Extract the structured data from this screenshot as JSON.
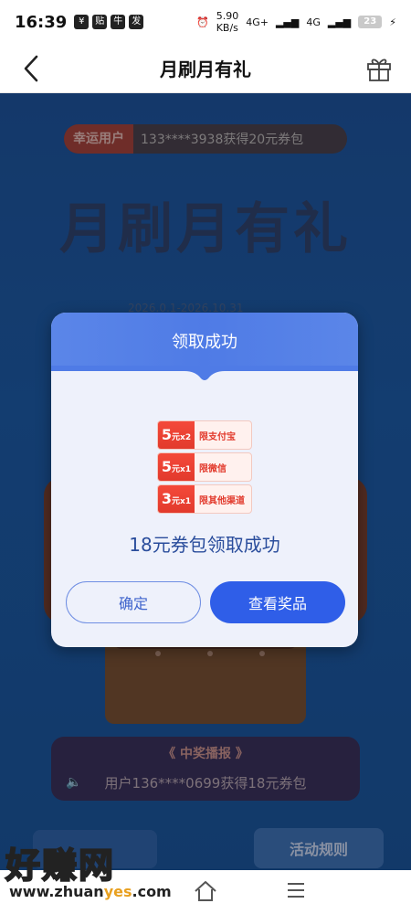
{
  "status_bar": {
    "time": "16:39",
    "net_speed": "5.90",
    "net_unit": "KB/s",
    "signal1": "4G+",
    "signal2": "4G",
    "battery": "23"
  },
  "nav": {
    "title": "月刷月有礼",
    "back_icon": "chevron-left-icon",
    "gift_icon": "gift-icon"
  },
  "background": {
    "lucky_tag": "幸运用户",
    "lucky_text": "133****3938获得20元券包",
    "big_title": "月刷月有礼",
    "date_text": "2026.0.1-2026.10.31",
    "broadcast_title": "《 中奖播报 》",
    "broadcast_item": "用户136****0699获得18元券包",
    "rules_button": "活动规则"
  },
  "dialog": {
    "title": "领取成功",
    "coupons": [
      {
        "amount": "5",
        "unit": "元x2",
        "label": "限支付宝"
      },
      {
        "amount": "5",
        "unit": "元x1",
        "label": "限微信"
      },
      {
        "amount": "3",
        "unit": "元x1",
        "label": "限其他渠道"
      }
    ],
    "success_text": "18元券包领取成功",
    "ok_label": "确定",
    "view_label": "查看奖品"
  },
  "watermark": {
    "cn": "好赚网",
    "url_pre": "www.zhuan",
    "url_hl": "yes",
    "url_post": ".com"
  },
  "colors": {
    "accent": "#2f5ee8",
    "dialog_header": "#4f7be6",
    "coupon_red": "#e23a2c"
  }
}
